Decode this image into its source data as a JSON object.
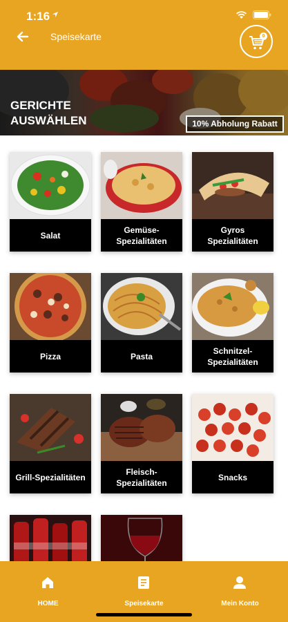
{
  "status_bar": {
    "time": "1:16"
  },
  "header": {
    "title": "Speisekarte",
    "cart_count": "0"
  },
  "banner": {
    "title": "GERICHTE AUSWÄHLEN",
    "badge": "10% Abholung Rabatt"
  },
  "categories": [
    {
      "label": "Salat"
    },
    {
      "label": "Gemüse-Spezialitäten"
    },
    {
      "label": "Gyros Spezialitäten"
    },
    {
      "label": "Pizza"
    },
    {
      "label": "Pasta"
    },
    {
      "label": "Schnitzel-Spezialitäten"
    },
    {
      "label": "Grill-Spezialitäten"
    },
    {
      "label": "Fleisch-Spezialitäten"
    },
    {
      "label": "Snacks"
    },
    {
      "label": ""
    },
    {
      "label": ""
    }
  ],
  "bottom_nav": {
    "home": "HOME",
    "menu": "Speisekarte",
    "account": "Mein Konto"
  },
  "colors": {
    "accent": "#e8a522",
    "card": "#000000"
  }
}
